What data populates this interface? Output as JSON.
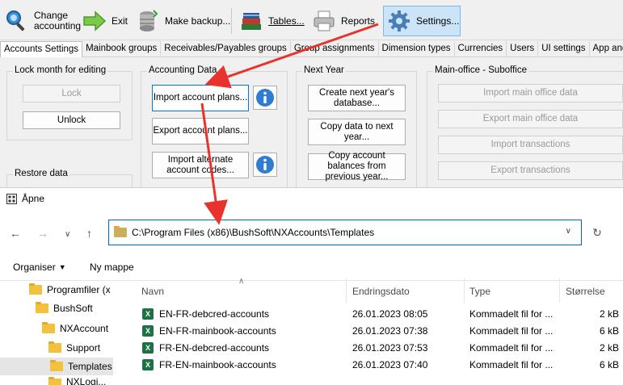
{
  "toolbar": {
    "change_accounting": "Change accounting",
    "exit": "Exit",
    "make_backup": "Make backup...",
    "tables": "Tables...",
    "reports": "Reports",
    "settings": "Settings..."
  },
  "tabs": [
    "Accounts Settings",
    "Mainbook groups",
    "Receivables/Payables groups",
    "Group assignments",
    "Dimension types",
    "Currencies",
    "Users",
    "UI settings",
    "App and Lice"
  ],
  "lock_group": {
    "title": "Lock month for editing",
    "lock": "Lock",
    "unlock": "Unlock"
  },
  "restore_group": {
    "title": "Restore data"
  },
  "accounting_group": {
    "title": "Accounting Data",
    "import_plans": "Import account plans...",
    "export_plans": "Export account plans...",
    "import_alt": "Import alternate account codes..."
  },
  "next_year_group": {
    "title": "Next Year",
    "create_db": "Create next year's database...",
    "copy_data": "Copy data to next year...",
    "copy_balances": "Copy account balances from previous year..."
  },
  "office_group": {
    "title": "Main-office - Suboffice",
    "import_main": "Import main office data",
    "export_main": "Export main office data",
    "import_tx": "Import transactions",
    "export_tx": "Export transactions"
  },
  "dialog": {
    "title": "Åpne",
    "path": "C:\\Program Files (x86)\\BushSoft\\NXAccounts\\Templates",
    "organise": "Organiser",
    "new_folder": "Ny mappe",
    "tree": [
      "Programfiler (x",
      "BushSoft",
      "NXAccount",
      "Support",
      "Templates",
      "NXLogi..."
    ],
    "columns": {
      "name": "Navn",
      "date": "Endringsdato",
      "type": "Type",
      "size": "Størrelse"
    },
    "files": [
      {
        "name": "EN-FR-debcred-accounts",
        "date": "26.01.2023 08:05",
        "type": "Kommadelt fil for ...",
        "size": "2 kB"
      },
      {
        "name": "EN-FR-mainbook-accounts",
        "date": "26.01.2023 07:38",
        "type": "Kommadelt fil for ...",
        "size": "6 kB"
      },
      {
        "name": "FR-EN-debcred-accounts",
        "date": "26.01.2023 07:53",
        "type": "Kommadelt fil for ...",
        "size": "2 kB"
      },
      {
        "name": "FR-EN-mainbook-accounts",
        "date": "26.01.2023 07:40",
        "type": "Kommadelt fil for ...",
        "size": "6 kB"
      }
    ]
  },
  "colors": {
    "arrow": "#e8322b",
    "accent": "#0067c0",
    "active_tool": "#cce4f7"
  }
}
